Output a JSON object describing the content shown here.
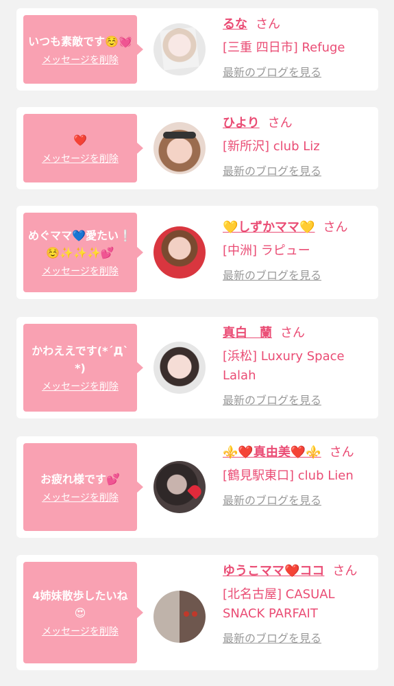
{
  "cards": [
    {
      "message": "いつも素敵です☺️💓",
      "delete_label": "メッセージを削除",
      "name": "るな",
      "honorific": "さん",
      "shop": "[三重 四日市] Refuge",
      "blog_link": "最新のブログを見る"
    },
    {
      "message": "❤️",
      "delete_label": "メッセージを削除",
      "name": "ひより",
      "honorific": "さん",
      "shop": "[新所沢] club Liz",
      "blog_link": "最新のブログを見る"
    },
    {
      "message": "めぐママ💙愛たい❕☺️✨✨✨💕",
      "delete_label": "メッセージを削除",
      "name": "💛しずかママ💛",
      "honorific": "さん",
      "shop": "[中洲] ラピュー",
      "blog_link": "最新のブログを見る"
    },
    {
      "message": "かわええです(*´Д`*)",
      "delete_label": "メッセージを削除",
      "name": "真白　蘭",
      "honorific": "さん",
      "shop": "[浜松] Luxury Space Lalah",
      "blog_link": "最新のブログを見る"
    },
    {
      "message": "お疲れ様です💕",
      "delete_label": "メッセージを削除",
      "name": "⚜️❤️真由美❤️⚜️",
      "honorific": "さん",
      "shop": "[鶴見駅東口] club Lien",
      "blog_link": "最新のブログを見る"
    },
    {
      "message": "4姉妹散歩したいね😍",
      "delete_label": "メッセージを削除",
      "name": "ゆうこママ❤️ココ",
      "honorific": "さん",
      "shop": "[北名古屋] CASUAL SNACK PARFAIT",
      "blog_link": "最新のブログを見る"
    }
  ]
}
